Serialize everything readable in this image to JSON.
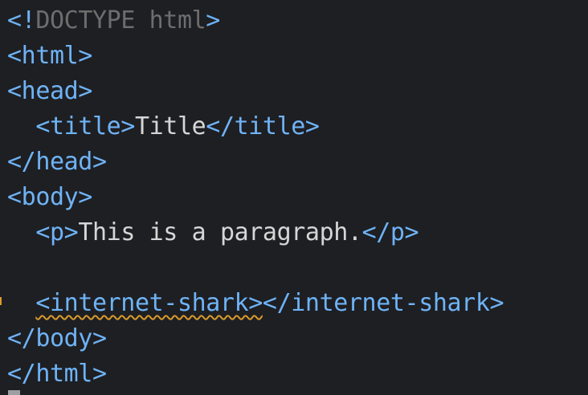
{
  "editor": {
    "lines": [
      {
        "tag_open": "<",
        "bang": "!",
        "doctype": "DOCTYPE html",
        "tag_close": ">"
      },
      {
        "tag": "<html>"
      },
      {
        "tag": "<head>"
      },
      {
        "indent": "  ",
        "open": "<title>",
        "text": "Title",
        "close": "</title>"
      },
      {
        "tag": "</head>"
      },
      {
        "tag": "<body>"
      },
      {
        "indent": "  ",
        "open": "<p>",
        "text": "This is a paragraph.",
        "close": "</p>"
      },
      {
        "tag": ""
      },
      {
        "indent": "  ",
        "open": "<internet-shark>",
        "close": "</internet-shark>"
      },
      {
        "tag": "</body>"
      },
      {
        "tag": "</html>"
      }
    ]
  },
  "colors": {
    "background": "#1e1f23",
    "tag": "#6fb3f6",
    "text": "#d6d6d6",
    "doctype": "#6d6d6d",
    "warning": "#d99a2a"
  }
}
